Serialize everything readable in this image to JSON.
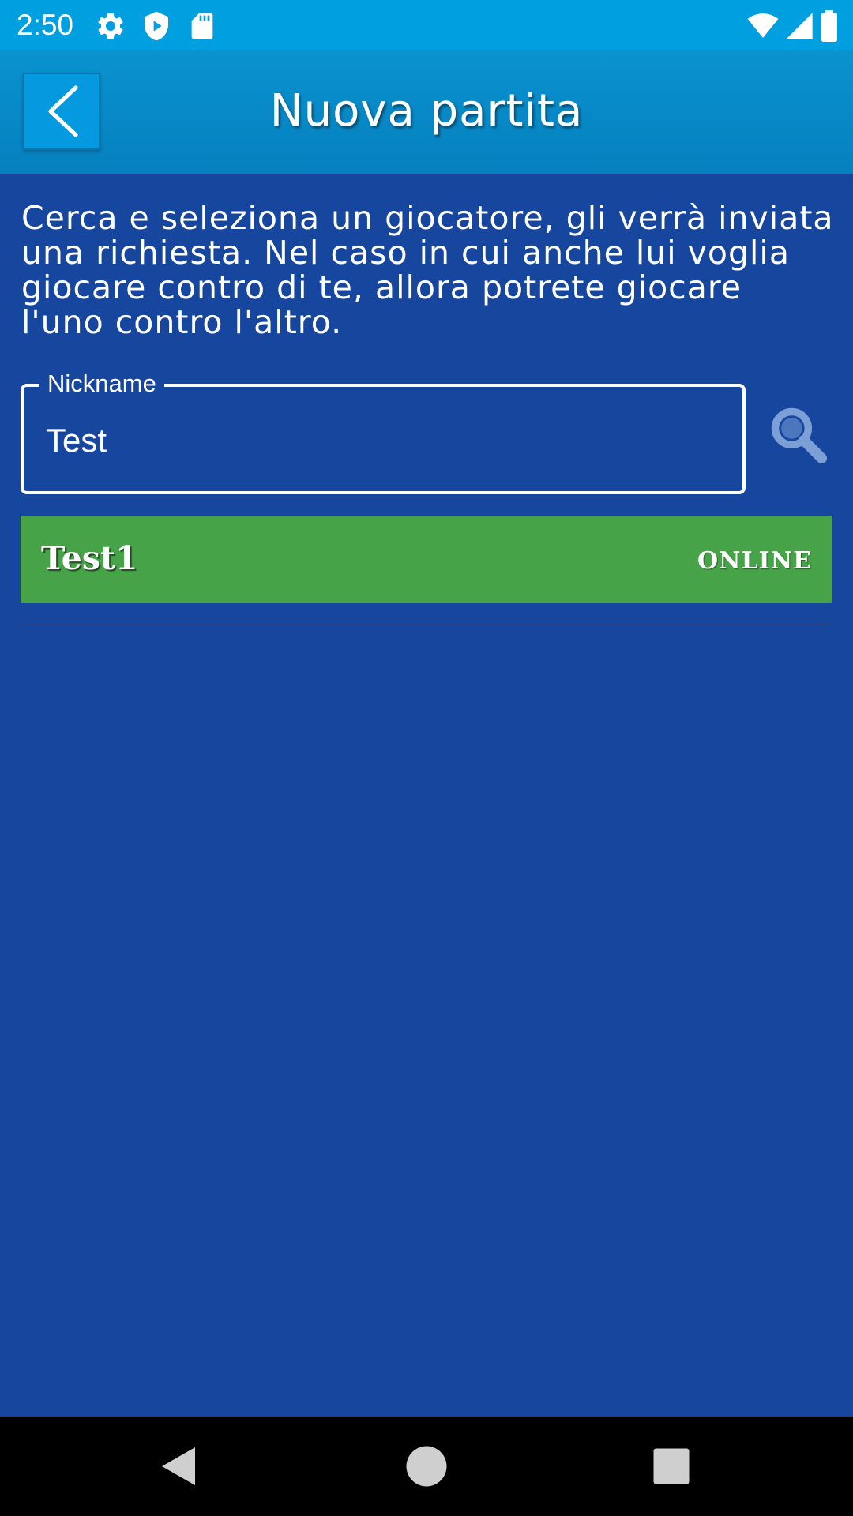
{
  "status_bar": {
    "time": "2:50",
    "left_icons": [
      "gear-icon",
      "shield-play-icon",
      "sd-card-icon"
    ],
    "right_icons": [
      "wifi-icon",
      "signal-icon",
      "battery-icon"
    ]
  },
  "app_bar": {
    "back_icon": "chevron-left-icon",
    "title": "Nuova partita"
  },
  "instruction": "Cerca e seleziona un giocatore, gli verrà inviata una richiesta. Nel caso in cui anche lui voglia giocare contro di te, allora potrete giocare l'uno contro l'altro.",
  "search": {
    "label": "Nickname",
    "value": "Test",
    "button_icon": "search-icon"
  },
  "results": [
    {
      "name": "Test1",
      "status": "ONLINE"
    }
  ],
  "nav_bar": {
    "icons": [
      "back-triangle-icon",
      "home-circle-icon",
      "recents-square-icon"
    ]
  },
  "colors": {
    "status_bar": "#009fdf",
    "app_bar": "#0a8cca",
    "background": "#17469e",
    "online_row": "#46a347",
    "search_icon": "#7c9fd6"
  }
}
